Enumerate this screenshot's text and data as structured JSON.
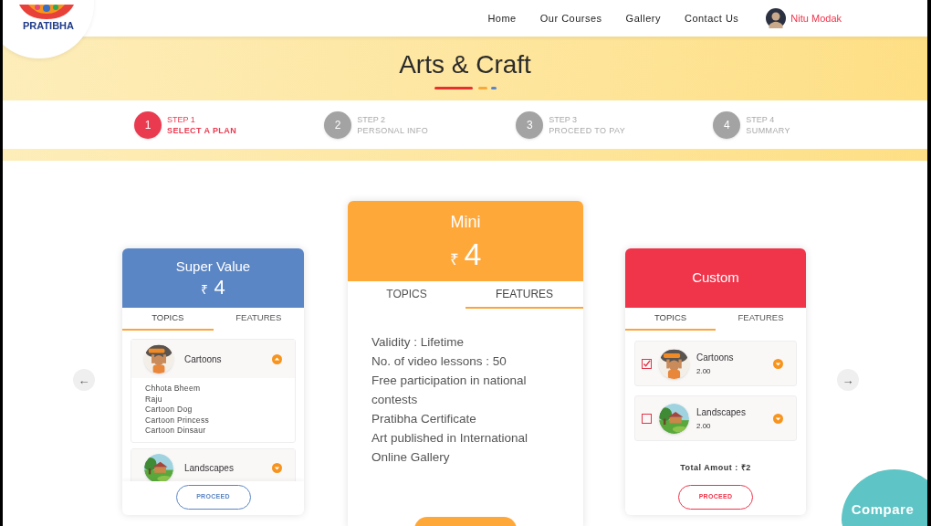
{
  "nav": {
    "logo": "PRATIBHA",
    "links": [
      {
        "label": "Home"
      },
      {
        "label": "Our Courses"
      },
      {
        "label": "Gallery"
      },
      {
        "label": "Contact Us"
      }
    ],
    "user": "Nitu Modak"
  },
  "banner": {
    "title": "Arts & Craft"
  },
  "steps": [
    {
      "number": "1",
      "step": "STEP 1",
      "label": "SELECT A PLAN",
      "selected": true
    },
    {
      "number": "2",
      "step": "STEP 2",
      "label": "PERSONAL INFO",
      "selected": false
    },
    {
      "number": "3",
      "step": "STEP 3",
      "label": "PROCEED TO PAY",
      "selected": false
    },
    {
      "number": "4",
      "step": "STEP 4",
      "label": "SUMMARY",
      "selected": false
    }
  ],
  "carousel": {
    "prev": "←",
    "next": "→"
  },
  "plans": [
    {
      "kind": "topics",
      "name": "Super Value",
      "currency": "₹",
      "price": "4",
      "color": "#5b86c5",
      "tabs": [
        {
          "label": "TOPICS",
          "selected": true
        },
        {
          "label": "FEATURES",
          "selected": false
        }
      ],
      "topics": [
        {
          "name": "Cartoons",
          "expanded": true,
          "children": [
            {
              "name": "Chhota Bheem"
            },
            {
              "name": "Raju"
            },
            {
              "name": "Cartoon Dog"
            },
            {
              "name": "Cartoon Princess"
            },
            {
              "name": "Cartoon Dinsaur"
            }
          ]
        },
        {
          "name": "Landscapes",
          "expanded": false
        }
      ],
      "button": "PROCEED"
    },
    {
      "kind": "features",
      "name": "Mini",
      "currency": "₹",
      "price": "4",
      "color": "#ffa83a",
      "tabs": [
        {
          "label": "TOPICS",
          "selected": false
        },
        {
          "label": "FEATURES",
          "selected": true
        }
      ],
      "features": [
        "Validity : Lifetime",
        "No. of video lessons : 50",
        "Free participation in national contests",
        "Pratibha Certificate",
        "Art published in International Online Gallery"
      ],
      "has_button": true
    },
    {
      "kind": "custom",
      "name": "Custom",
      "color": "#f0344a",
      "tabs": [
        {
          "label": "TOPICS",
          "selected": true
        },
        {
          "label": "FEATURES",
          "selected": false
        }
      ],
      "topics": [
        {
          "name": "Cartoons",
          "price": "2.00",
          "checked": true,
          "expanded": false
        },
        {
          "name": "Landscapes",
          "price": "2.00",
          "checked": false,
          "expanded": false
        }
      ],
      "total": "Total Amout : ₹2",
      "button": "PROCEED"
    }
  ],
  "compare": "Compare"
}
